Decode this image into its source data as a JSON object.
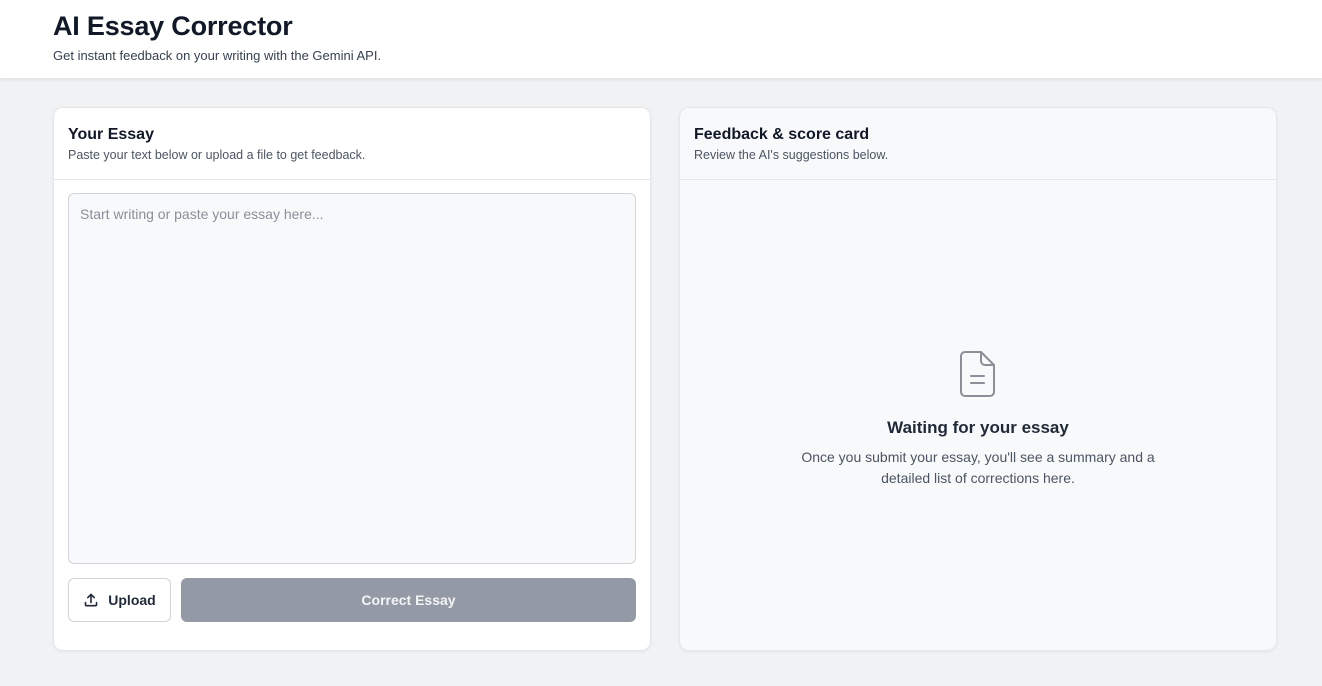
{
  "header": {
    "title": "AI Essay Corrector",
    "subtitle": "Get instant feedback on your writing with the Gemini API."
  },
  "essay_panel": {
    "title": "Your Essay",
    "description": "Paste your text below or upload a file to get feedback.",
    "textarea": {
      "value": "",
      "placeholder": "Start writing or paste your essay here..."
    },
    "upload_label": "Upload",
    "upload_icon": "upload-icon",
    "submit_label": "Correct Essay",
    "submit_disabled": true
  },
  "feedback_panel": {
    "title": "Feedback & score card",
    "description": "Review the AI's suggestions below.",
    "empty_state": {
      "icon": "document-icon",
      "title": "Waiting for your essay",
      "description": "Once you submit your essay, you'll see a summary and a detailed list of corrections here."
    }
  },
  "colors": {
    "page_background": "#f1f2f4",
    "disabled_button": "#949aa5",
    "icon_gray": "#8a8f98"
  }
}
